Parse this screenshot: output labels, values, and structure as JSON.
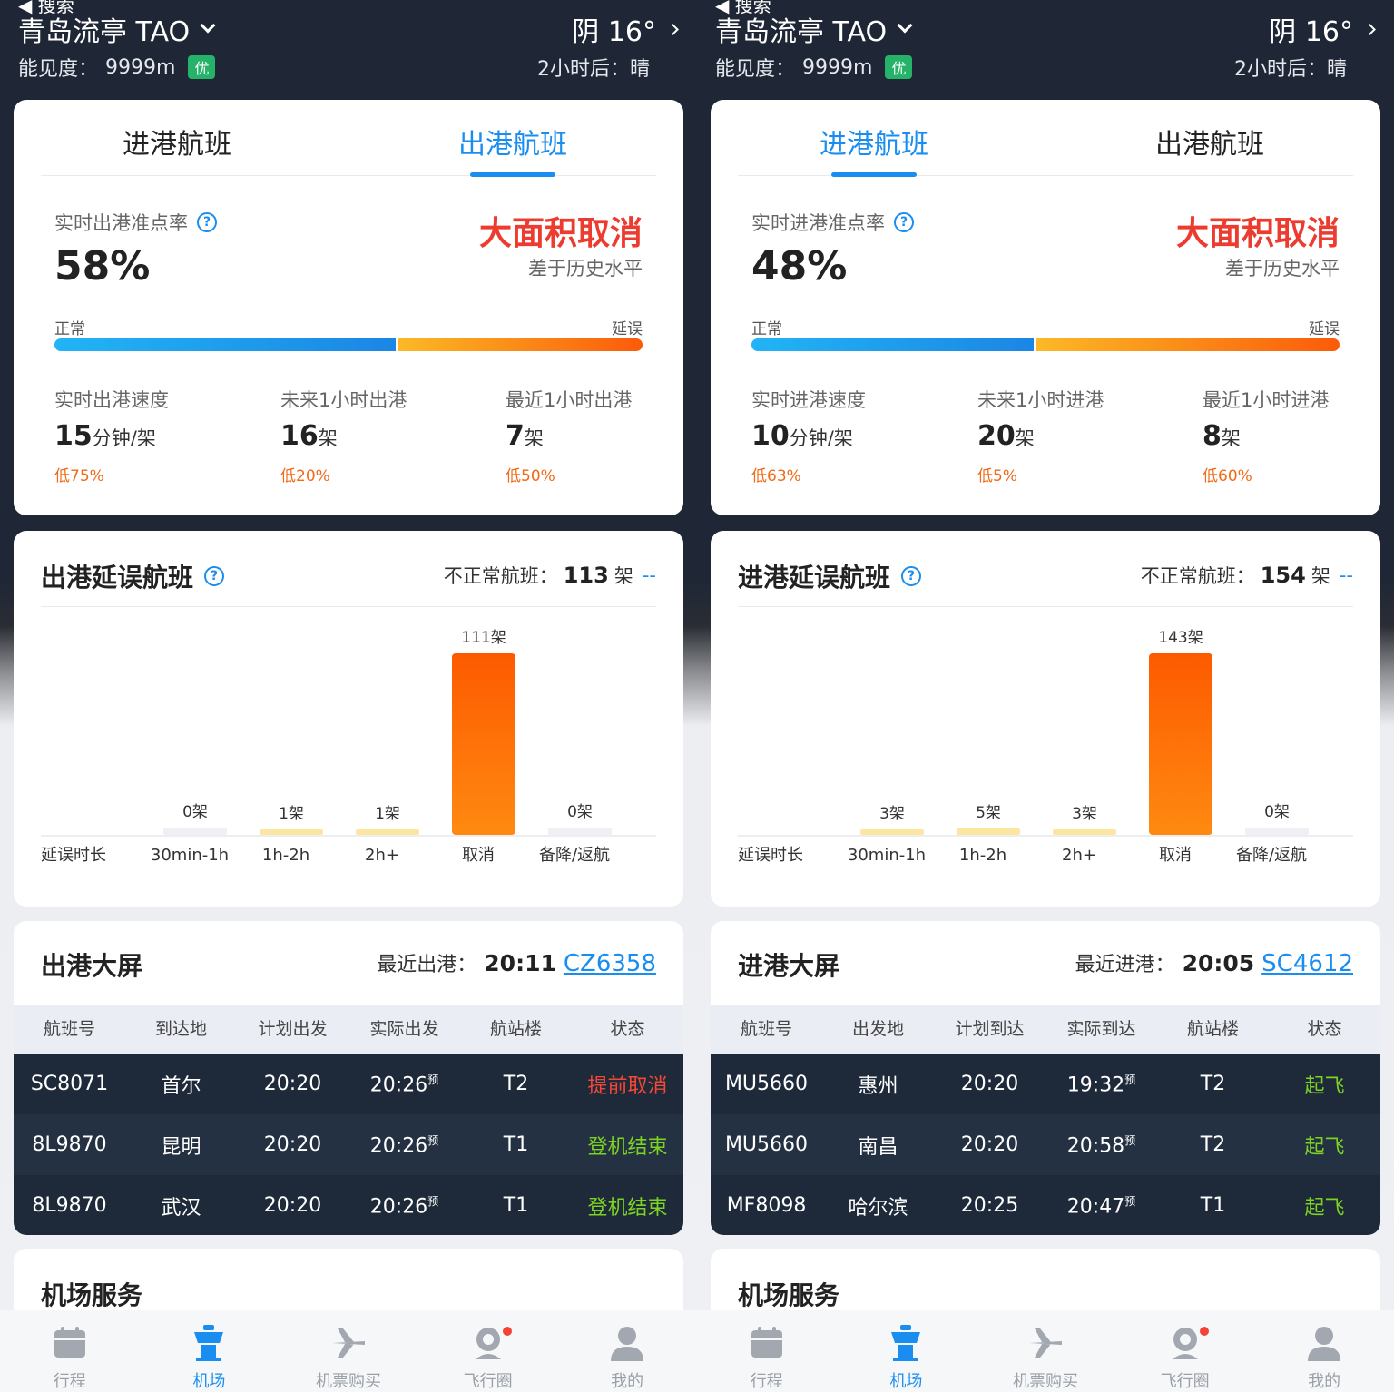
{
  "header": {
    "back": "◀ 搜索",
    "city": "青岛流亭 TAO",
    "weather": "阴 16°",
    "visibility_label": "能见度：",
    "visibility_value": "9999m",
    "visibility_badge": "优",
    "forecast": "2小时后：晴"
  },
  "panels": [
    {
      "tabs": {
        "arrive": "进港航班",
        "depart": "出港航班",
        "active": "depart"
      },
      "rate_label": "实时出港准点率",
      "rate_value": "58%",
      "status": "大面积取消",
      "status_sub": "差于历史水平",
      "bar_normal": "正常",
      "bar_delay": "延误",
      "bar_normal_fraction": 0.58,
      "stats": [
        {
          "label": "实时出港速度",
          "value": "15",
          "unit": "分钟/架",
          "diff": "低75%"
        },
        {
          "label": "未来1小时出港",
          "value": "16",
          "unit": "架",
          "diff": "低20%"
        },
        {
          "label": "最近1小时出港",
          "value": "7",
          "unit": "架",
          "diff": "低50%"
        }
      ],
      "delay_title": "出港延误航班",
      "abnormal_label": "不正常航班：",
      "abnormal_value": "113",
      "abnormal_unit": "架",
      "abnormal_dash": "--",
      "chart_data": {
        "type": "bar",
        "axis_label": "延误时长",
        "categories": [
          "30min-1h",
          "1h-2h",
          "2h+",
          "取消",
          "备降/返航"
        ],
        "values": [
          0,
          1,
          1,
          111,
          0
        ],
        "data_labels": [
          "0架",
          "1架",
          "1架",
          "111架",
          "0架"
        ]
      },
      "board_title": "出港大屏",
      "recent_label": "最近出港：",
      "recent_time": "20:11",
      "recent_flight": "CZ6358",
      "columns": [
        "航班号",
        "到达地",
        "计划出发",
        "实际出发",
        "航站楼",
        "状态"
      ],
      "rows": [
        {
          "flight": "SC8071",
          "place": "首尔",
          "plan": "20:20",
          "actual": "20:26",
          "mark": "预",
          "terminal": "T2",
          "status": "提前取消",
          "status_color": "red"
        },
        {
          "flight": "8L9870",
          "place": "昆明",
          "plan": "20:20",
          "actual": "20:26",
          "mark": "预",
          "terminal": "T1",
          "status": "登机结束",
          "status_color": "green"
        },
        {
          "flight": "8L9870",
          "place": "武汉",
          "plan": "20:20",
          "actual": "20:26",
          "mark": "预",
          "terminal": "T1",
          "status": "登机结束",
          "status_color": "green"
        }
      ],
      "service_title": "机场服务"
    },
    {
      "tabs": {
        "arrive": "进港航班",
        "depart": "出港航班",
        "active": "arrive"
      },
      "rate_label": "实时进港准点率",
      "rate_value": "48%",
      "status": "大面积取消",
      "status_sub": "差于历史水平",
      "bar_normal": "正常",
      "bar_delay": "延误",
      "bar_normal_fraction": 0.48,
      "stats": [
        {
          "label": "实时进港速度",
          "value": "10",
          "unit": "分钟/架",
          "diff": "低63%"
        },
        {
          "label": "未来1小时进港",
          "value": "20",
          "unit": "架",
          "diff": "低5%"
        },
        {
          "label": "最近1小时进港",
          "value": "8",
          "unit": "架",
          "diff": "低60%"
        }
      ],
      "delay_title": "进港延误航班",
      "abnormal_label": "不正常航班：",
      "abnormal_value": "154",
      "abnormal_unit": "架",
      "abnormal_dash": "--",
      "chart_data": {
        "type": "bar",
        "axis_label": "延误时长",
        "categories": [
          "30min-1h",
          "1h-2h",
          "2h+",
          "取消",
          "备降/返航"
        ],
        "values": [
          3,
          5,
          3,
          143,
          0
        ],
        "data_labels": [
          "3架",
          "5架",
          "3架",
          "143架",
          "0架"
        ]
      },
      "board_title": "进港大屏",
      "recent_label": "最近进港：",
      "recent_time": "20:05",
      "recent_flight": "SC4612",
      "columns": [
        "航班号",
        "出发地",
        "计划到达",
        "实际到达",
        "航站楼",
        "状态"
      ],
      "rows": [
        {
          "flight": "MU5660",
          "place": "惠州",
          "plan": "20:20",
          "actual": "19:32",
          "mark": "预",
          "terminal": "T2",
          "status": "起飞",
          "status_color": "green"
        },
        {
          "flight": "MU5660",
          "place": "南昌",
          "plan": "20:20",
          "actual": "20:58",
          "mark": "预",
          "terminal": "T2",
          "status": "起飞",
          "status_color": "green"
        },
        {
          "flight": "MF8098",
          "place": "哈尔滨",
          "plan": "20:25",
          "actual": "20:47",
          "mark": "预",
          "terminal": "T1",
          "status": "起飞",
          "status_color": "green"
        }
      ],
      "service_title": "机场服务"
    }
  ],
  "tabbar": [
    {
      "label": "行程",
      "icon": "calendar-icon"
    },
    {
      "label": "机场",
      "icon": "control-tower-icon",
      "active": true
    },
    {
      "label": "机票购买",
      "icon": "airplane-icon"
    },
    {
      "label": "飞行圈",
      "icon": "community-icon",
      "dot": true
    },
    {
      "label": "我的",
      "icon": "profile-icon"
    }
  ],
  "colors": {
    "accent": "#1a8ef0",
    "danger": "#ec3b2f",
    "orange": "#f06a18",
    "green": "#7cd321",
    "header_bg": "#1f2736"
  }
}
